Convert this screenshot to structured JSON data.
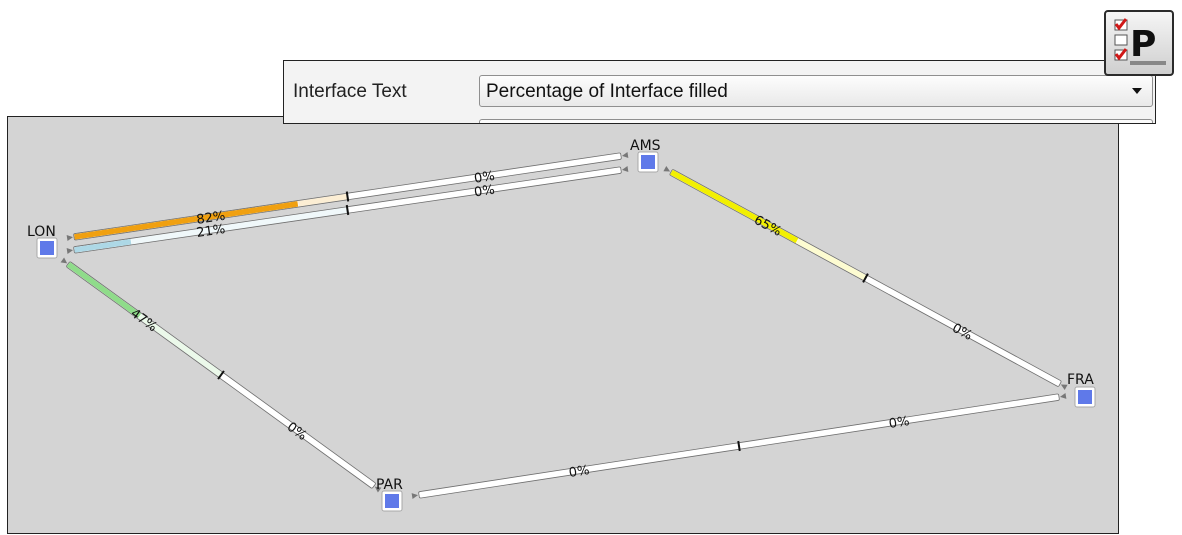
{
  "properties_panel": {
    "field_label": "Interface Text",
    "selected_option": "Percentage of Interface filled"
  },
  "toolbar": {
    "properties_button_icon": "properties-checklist-icon",
    "properties_button_letter": "P"
  },
  "colors": {
    "canvas_background": "#d4d4d4",
    "node_fill": "#5f79e9",
    "util_high": "#f0a010",
    "util_medium_high": "#f2f000",
    "util_medium": "#8fdc8a",
    "util_low": "#add8e6",
    "util_empty": "#ffffff"
  },
  "topology": {
    "nodes": [
      {
        "id": "LON",
        "label": "LON"
      },
      {
        "id": "AMS",
        "label": "AMS"
      },
      {
        "id": "FRA",
        "label": "FRA"
      },
      {
        "id": "PAR",
        "label": "PAR"
      }
    ],
    "links": [
      {
        "name": "lon-ams-upper",
        "interfaces": [
          {
            "from": "LON",
            "utilization": 0.82,
            "label": "82%",
            "color": "#f0a010"
          },
          {
            "from": "AMS",
            "utilization": 0,
            "label": "0%",
            "color": "#ffffff"
          }
        ]
      },
      {
        "name": "lon-ams-lower",
        "interfaces": [
          {
            "from": "LON",
            "utilization": 0.21,
            "label": "21%",
            "color": "#add8e6"
          },
          {
            "from": "AMS",
            "utilization": 0,
            "label": "0%",
            "color": "#ffffff"
          }
        ]
      },
      {
        "name": "ams-fra",
        "interfaces": [
          {
            "from": "AMS",
            "utilization": 0.65,
            "label": "65%",
            "color": "#f2f000"
          },
          {
            "from": "FRA",
            "utilization": 0,
            "label": "0%",
            "color": "#ffffff"
          }
        ]
      },
      {
        "name": "lon-par",
        "interfaces": [
          {
            "from": "LON",
            "utilization": 0.47,
            "label": "47%",
            "color": "#8fdc8a"
          },
          {
            "from": "PAR",
            "utilization": 0,
            "label": "0%",
            "color": "#ffffff"
          }
        ]
      },
      {
        "name": "par-fra",
        "interfaces": [
          {
            "from": "PAR",
            "utilization": 0,
            "label": "0%",
            "color": "#ffffff"
          },
          {
            "from": "FRA",
            "utilization": 0,
            "label": "0%",
            "color": "#ffffff"
          }
        ]
      }
    ]
  }
}
